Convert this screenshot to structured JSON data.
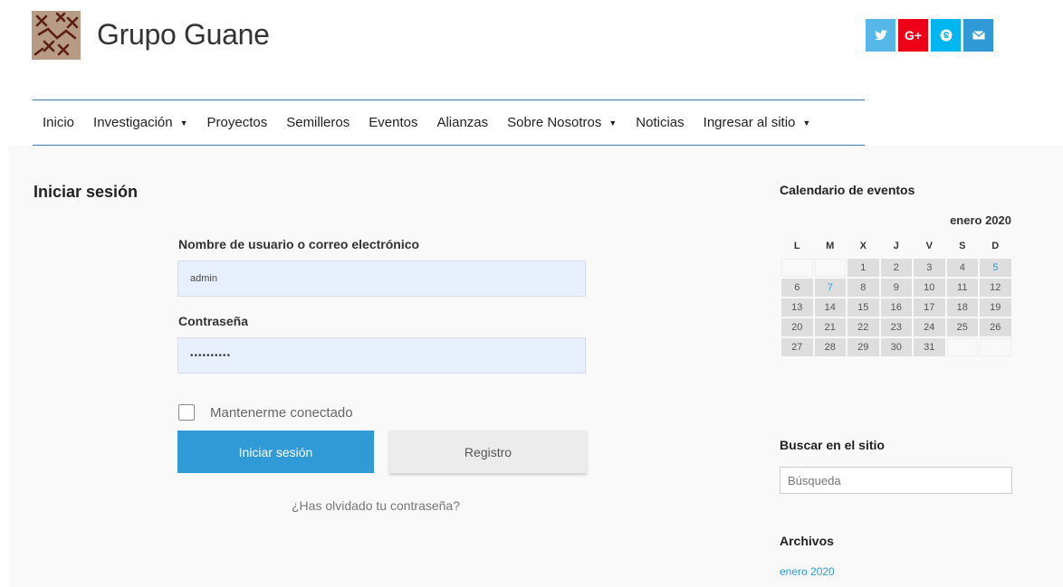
{
  "header": {
    "site_title": "Grupo Guane",
    "social": [
      {
        "icon": "twitter-icon",
        "color": "#55b8e8"
      },
      {
        "icon": "google-plus-icon",
        "label": "G+",
        "color": "#ee0016"
      },
      {
        "icon": "skype-icon",
        "color": "#00b6f0"
      },
      {
        "icon": "email-icon",
        "color": "#2f9ad6"
      }
    ]
  },
  "nav": {
    "items": [
      {
        "label": "Inicio",
        "dropdown": false
      },
      {
        "label": "Investigación",
        "dropdown": true
      },
      {
        "label": "Proyectos",
        "dropdown": false
      },
      {
        "label": "Semilleros",
        "dropdown": false
      },
      {
        "label": "Eventos",
        "dropdown": false
      },
      {
        "label": "Alianzas",
        "dropdown": false
      },
      {
        "label": "Sobre Nosotros",
        "dropdown": true
      },
      {
        "label": "Noticias",
        "dropdown": false
      },
      {
        "label": "Ingresar al sitio",
        "dropdown": true
      }
    ],
    "caret": "▼"
  },
  "login": {
    "heading": "Iniciar sesión",
    "username_label": "Nombre de usuario o correo electrónico",
    "username_value": "admin",
    "password_label": "Contraseña",
    "password_value": "••••••••••",
    "remember_label": "Mantenerme conectado",
    "remember_checked": false,
    "login_button": "Iniciar sesión",
    "register_button": "Registro",
    "forgot_link": "¿Has olvidado tu contraseña?"
  },
  "sidebar": {
    "calendar": {
      "title": "Calendario de eventos",
      "month": "enero 2020",
      "weekdays": [
        "L",
        "M",
        "X",
        "J",
        "V",
        "S",
        "D"
      ],
      "weeks": [
        [
          "",
          "",
          "1",
          "2",
          "3",
          "4",
          "5"
        ],
        [
          "6",
          "7",
          "8",
          "9",
          "10",
          "11",
          "12"
        ],
        [
          "13",
          "14",
          "15",
          "16",
          "17",
          "18",
          "19"
        ],
        [
          "20",
          "21",
          "22",
          "23",
          "24",
          "25",
          "26"
        ],
        [
          "27",
          "28",
          "29",
          "30",
          "31",
          "",
          ""
        ]
      ],
      "linked_days": [
        "5",
        "7"
      ]
    },
    "search": {
      "title": "Buscar en el sitio",
      "placeholder": "Búsqueda"
    },
    "archives": {
      "title": "Archivos",
      "items": [
        "enero 2020"
      ]
    }
  }
}
